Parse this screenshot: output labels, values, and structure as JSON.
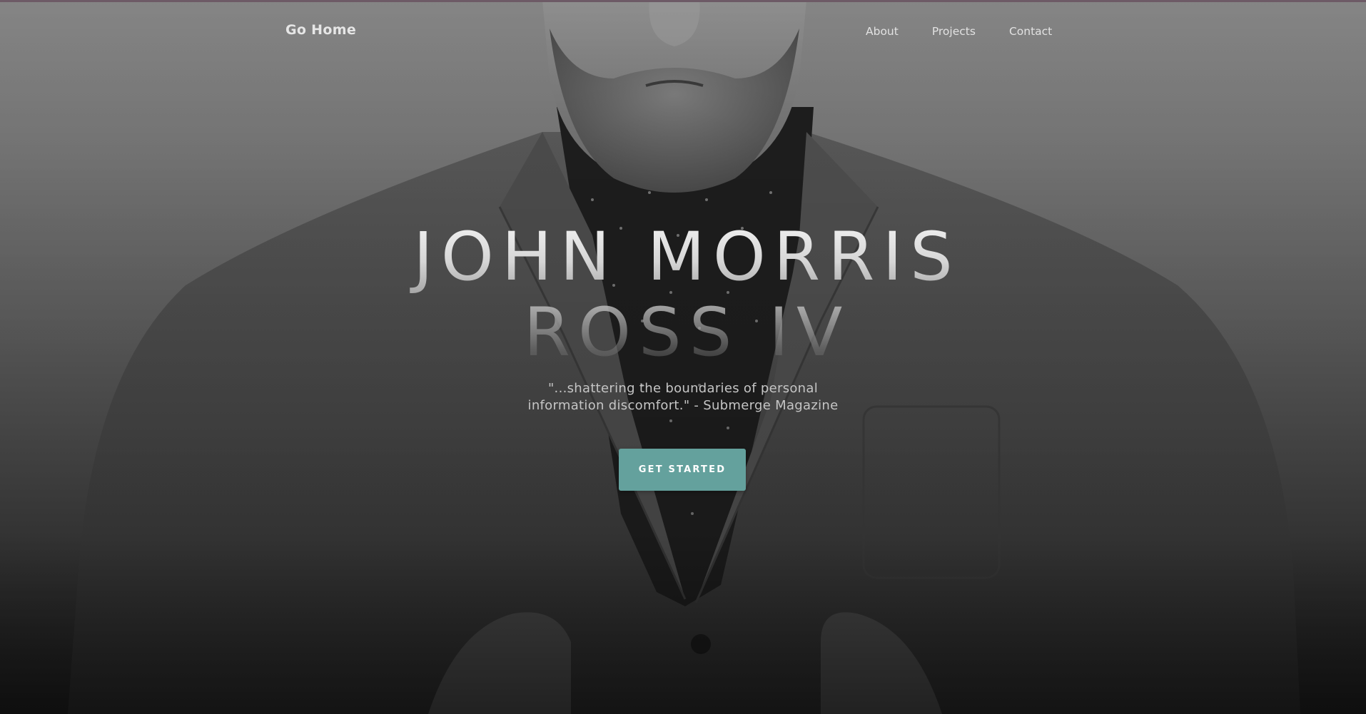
{
  "navbar": {
    "brand": "Go Home",
    "links": [
      {
        "label": "About"
      },
      {
        "label": "Projects"
      },
      {
        "label": "Contact"
      }
    ]
  },
  "hero": {
    "title_line1": "JOHN MORRIS",
    "title_line2": "ROSS IV",
    "quote_line1": "\"...shattering the boundaries of personal",
    "quote_line2": "information discomfort.\" - Submerge Magazine",
    "cta_label": "GET STARTED",
    "background_image": "portrait-of-bearded-man-in-suit-jacket"
  },
  "colors": {
    "accent": "#64a19d",
    "top_border": "#6d5a66"
  }
}
